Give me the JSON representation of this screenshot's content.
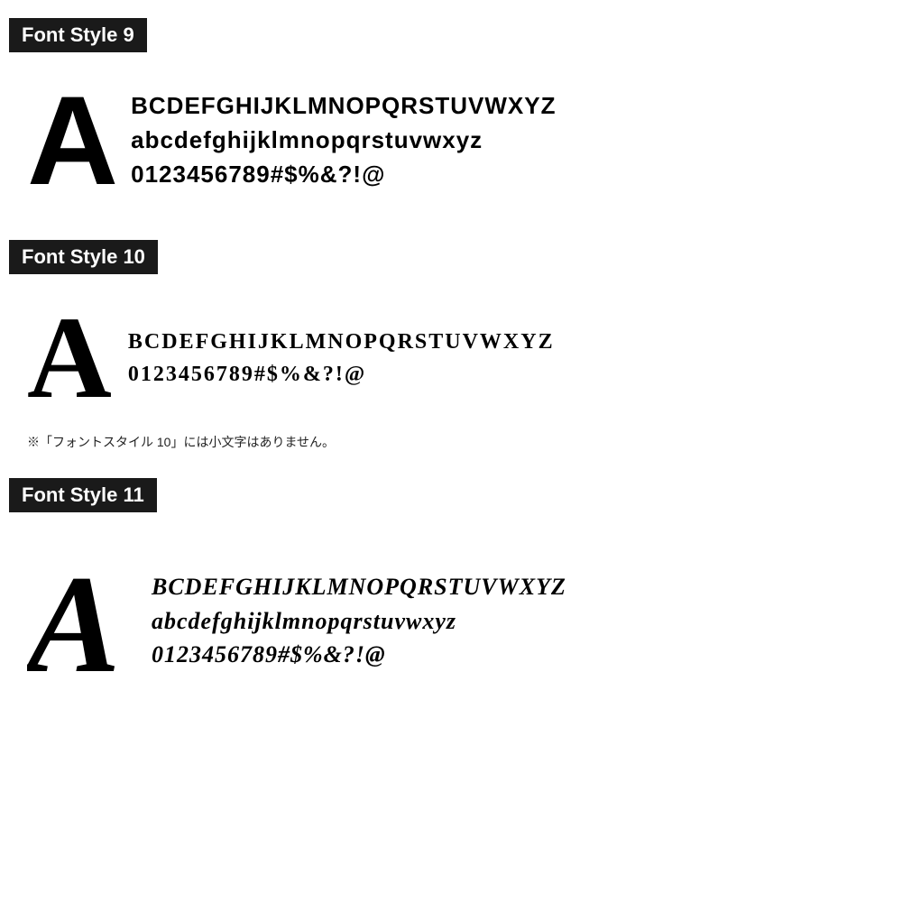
{
  "sections": [
    {
      "id": "style9",
      "label": "Font Style 9",
      "big_letter": "A",
      "line1": "BCDEFGHIJKLMNOPQRSTUVWXYZ",
      "line2": "abcdefghijklmnopqrstuvwxyz",
      "line3": "0123456789#$%&?!@",
      "note": null
    },
    {
      "id": "style10",
      "label": "Font Style 10",
      "big_letter": "A",
      "line1": "BCDEFGHIJKLMNOPQRSTUVWXYZ",
      "line2": "0123456789#$%&?!@",
      "line3": null,
      "note": "※「フォントスタイル 10」には小文字はありません。"
    },
    {
      "id": "style11",
      "label": "Font Style 11",
      "big_letter": "A",
      "line1": "BCDEFGHIJKLMNOPQRSTUVWXYZ",
      "line2": "abcdefghijklmnopqrstuvwxyz",
      "line3": "0123456789#$%&?!@",
      "note": null
    }
  ]
}
